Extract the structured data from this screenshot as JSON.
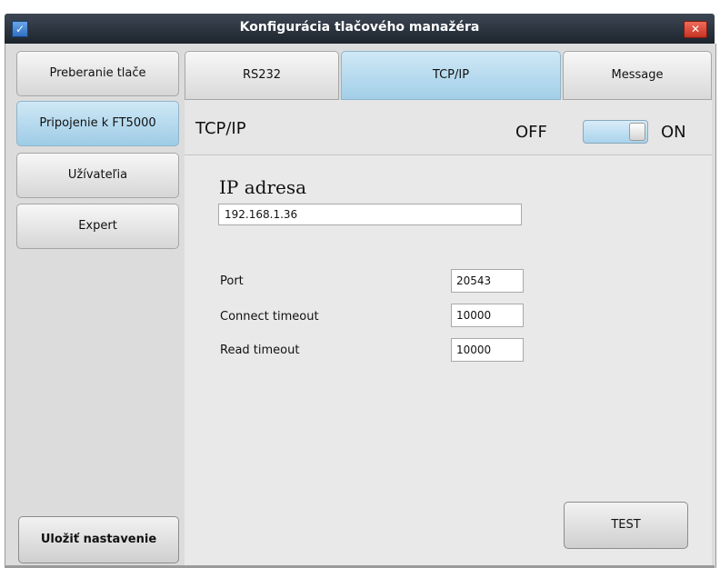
{
  "window": {
    "title": "Konfigurácia tlačového manažéra",
    "app_icon": "checkmark-icon",
    "close_icon": "close-icon"
  },
  "sidebar": {
    "items": [
      {
        "label": "Preberanie tlače",
        "active": false
      },
      {
        "label": "Pripojenie k FT5000",
        "active": true
      },
      {
        "label": "Užívateľia",
        "active": false
      },
      {
        "label": "Expert",
        "active": false
      }
    ],
    "save_label": "Uložiť nastavenie"
  },
  "tabs": [
    {
      "label": "RS232",
      "active": false
    },
    {
      "label": "TCP/IP",
      "active": true
    },
    {
      "label": "Message",
      "active": false
    }
  ],
  "panel": {
    "title": "TCP/IP",
    "toggle": {
      "off_label": "OFF",
      "on_label": "ON",
      "state": "on"
    },
    "ip": {
      "label": "IP adresa",
      "value": "192.168.1.36"
    },
    "fields": [
      {
        "label": "Port",
        "value": "20543"
      },
      {
        "label": "Connect timeout",
        "value": "10000"
      },
      {
        "label": "Read timeout",
        "value": "10000"
      }
    ],
    "test_label": "TEST"
  },
  "colors": {
    "active_blue": "#a9d3ec",
    "titlebar": "#2a323c",
    "close_red": "#d94433"
  }
}
